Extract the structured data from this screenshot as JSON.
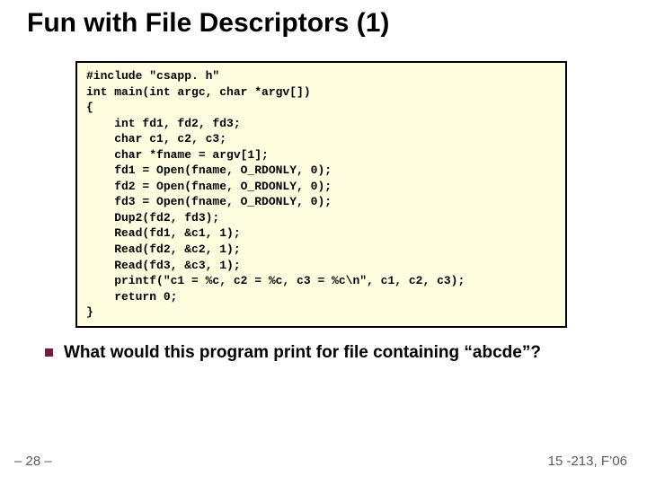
{
  "title": "Fun with File Descriptors (1)",
  "code": "#include \"csapp. h\"\nint main(int argc, char *argv[])\n{\n    int fd1, fd2, fd3;\n    char c1, c2, c3;\n    char *fname = argv[1];\n    fd1 = Open(fname, O_RDONLY, 0);\n    fd2 = Open(fname, O_RDONLY, 0);\n    fd3 = Open(fname, O_RDONLY, 0);\n    Dup2(fd2, fd3);\n    Read(fd1, &c1, 1);\n    Read(fd2, &c2, 1);\n    Read(fd3, &c3, 1);\n    printf(\"c1 = %c, c2 = %c, c3 = %c\\n\", c1, c2, c3);\n    return 0;\n}",
  "bullet_text": "What would this program print for file containing “abcde”?",
  "page_num": "– 28 –",
  "course": "15 -213, F’06"
}
